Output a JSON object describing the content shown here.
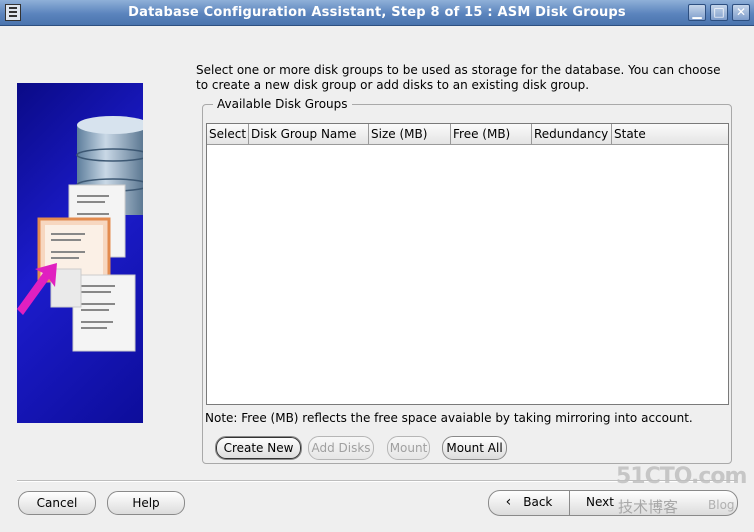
{
  "window": {
    "title": "Database Configuration Assistant, Step 8 of 15 : ASM Disk Groups",
    "controls": {
      "minimize": "▁",
      "maximize": "□",
      "close": "✕"
    }
  },
  "instruction": "Select one or more disk groups to be used as storage for the database. You can choose to create a new disk group or add disks to an existing disk group.",
  "group": {
    "legend": "Available Disk Groups",
    "columns": [
      "Select",
      "Disk Group Name",
      "Size (MB)",
      "Free (MB)",
      "Redundancy",
      "State"
    ],
    "rows": [],
    "note": "Note: Free (MB) reflects the free space avaiable by taking mirroring into account."
  },
  "group_buttons": {
    "create_new": "Create New",
    "add_disks": "Add Disks",
    "mount": "Mount",
    "mount_all": "Mount All"
  },
  "footer": {
    "cancel": "Cancel",
    "help": "Help",
    "back": "Back",
    "next": "Next",
    "back_arrow": "‹"
  },
  "watermark": {
    "main": "51CTO.com",
    "sub": "技术博客",
    "blog": "Blog"
  }
}
